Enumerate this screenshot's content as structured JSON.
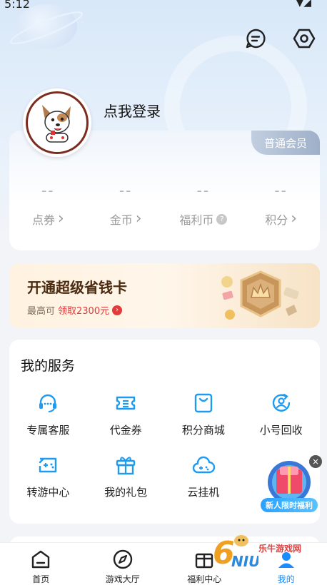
{
  "status": {
    "time": "5:12"
  },
  "profile": {
    "login_text": "点我登录",
    "member_level": "普通会员",
    "stats": [
      {
        "value": "--",
        "label": "点券",
        "suffix": "›"
      },
      {
        "value": "--",
        "label": "金币",
        "suffix": "›"
      },
      {
        "value": "--",
        "label": "福利币",
        "suffix": "?"
      },
      {
        "value": "--",
        "label": "积分",
        "suffix": "›"
      }
    ]
  },
  "saver": {
    "title": "开通超级省钱卡",
    "sub_prefix": "最高可",
    "sub_highlight": "领取2300元"
  },
  "services": {
    "title": "我的服务",
    "items": [
      {
        "label": "专属客服",
        "icon": "headset-icon"
      },
      {
        "label": "代金券",
        "icon": "voucher-icon"
      },
      {
        "label": "积分商城",
        "icon": "shopping-bag-icon"
      },
      {
        "label": "小号回收",
        "icon": "recycle-user-icon"
      },
      {
        "label": "转游中心",
        "icon": "transfer-game-icon"
      },
      {
        "label": "我的礼包",
        "icon": "gift-icon"
      },
      {
        "label": "云挂机",
        "icon": "cloud-gamepad-icon"
      }
    ]
  },
  "promo": {
    "label": "新人限时福利"
  },
  "tabbar": {
    "items": [
      {
        "label": "首页",
        "icon": "home-icon"
      },
      {
        "label": "游戏大厅",
        "icon": "compass-icon"
      },
      {
        "label": "福利中心",
        "icon": "welfare-icon"
      },
      {
        "label": "我的",
        "icon": "profile-icon",
        "active": true
      }
    ]
  },
  "watermark": {
    "text": "乐牛游戏网"
  },
  "colors": {
    "accent": "#1a8cff",
    "highlight": "#e23b3b",
    "icon_blue": "#1e9bf0"
  }
}
